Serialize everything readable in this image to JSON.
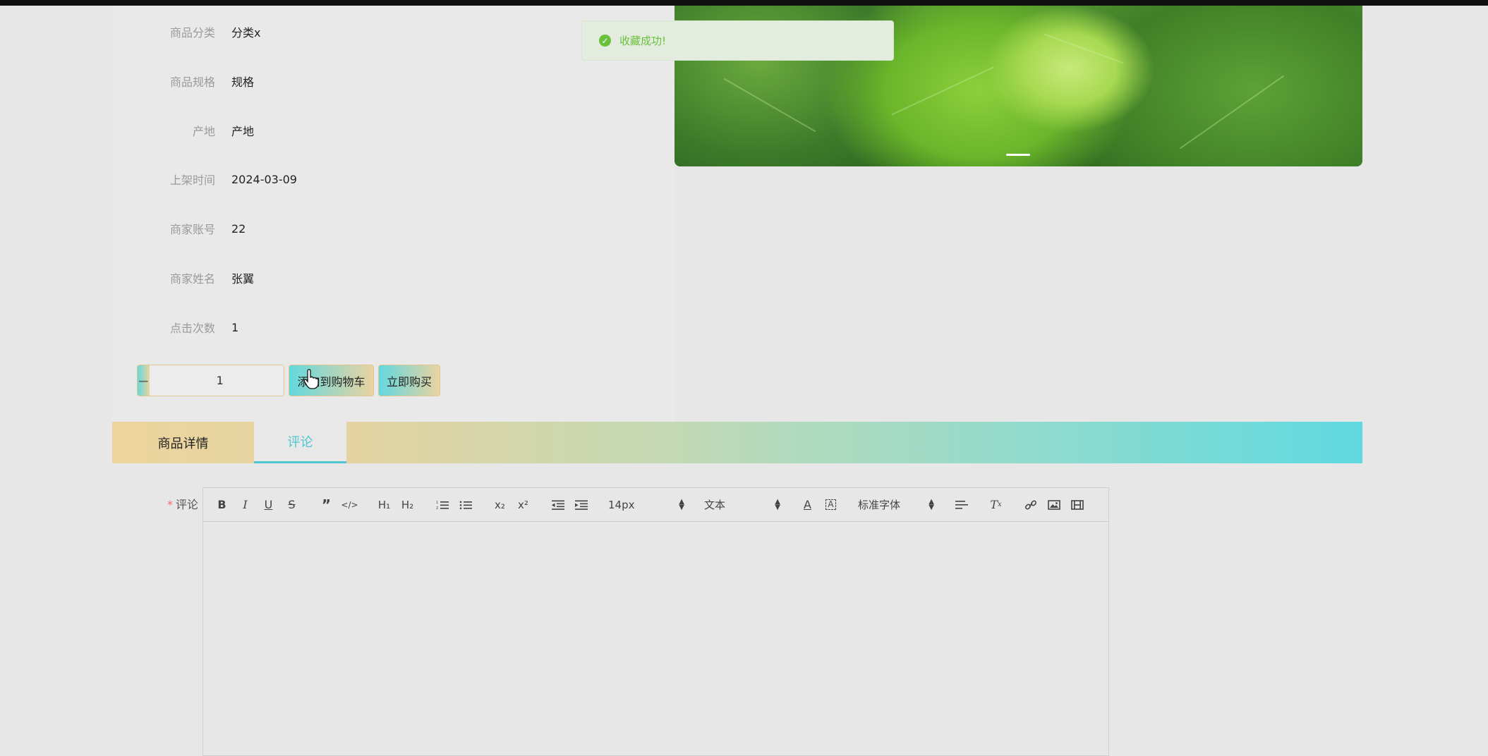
{
  "toast": {
    "message": "收藏成功!",
    "icon": "check-circle-icon",
    "color": "#67c23a"
  },
  "product_info": {
    "rows": [
      {
        "label": "商品分类",
        "value": "分类x"
      },
      {
        "label": "商品规格",
        "value": "规格"
      },
      {
        "label": "产地",
        "value": "产地"
      },
      {
        "label": "上架时间",
        "value": "2024-03-09"
      },
      {
        "label": "商家账号",
        "value": "22"
      },
      {
        "label": "商家姓名",
        "value": "张翼"
      },
      {
        "label": "点击次数",
        "value": "1"
      }
    ]
  },
  "quantity": {
    "minus": "−",
    "plus": "+",
    "value": "1"
  },
  "actions": {
    "add_to_cart": "添加到购物车",
    "buy_now": "立即购买"
  },
  "tabs": [
    {
      "label": "商品详情",
      "active": false
    },
    {
      "label": "评论",
      "active": true
    }
  ],
  "comment": {
    "required_mark": "*",
    "label": "评论",
    "toolbar": {
      "font_size": "14px",
      "header_select": "文本",
      "font_family": "标准字体",
      "buttons": [
        "bold-icon",
        "italic-icon",
        "underline-icon",
        "strike-icon",
        "blockquote-icon",
        "code-block-icon",
        "h1-icon",
        "h2-icon",
        "ordered-list-icon",
        "bullet-list-icon",
        "subscript-icon",
        "superscript-icon",
        "outdent-icon",
        "indent-icon",
        "font-color-icon",
        "background-color-icon",
        "align-icon",
        "clean-format-icon",
        "link-icon",
        "image-icon",
        "video-icon"
      ]
    }
  },
  "colors": {
    "accent_teal": "#4fc5cf",
    "gradient_start": "#62d8df",
    "gradient_end": "#e9d3a1",
    "success": "#67c23a"
  }
}
